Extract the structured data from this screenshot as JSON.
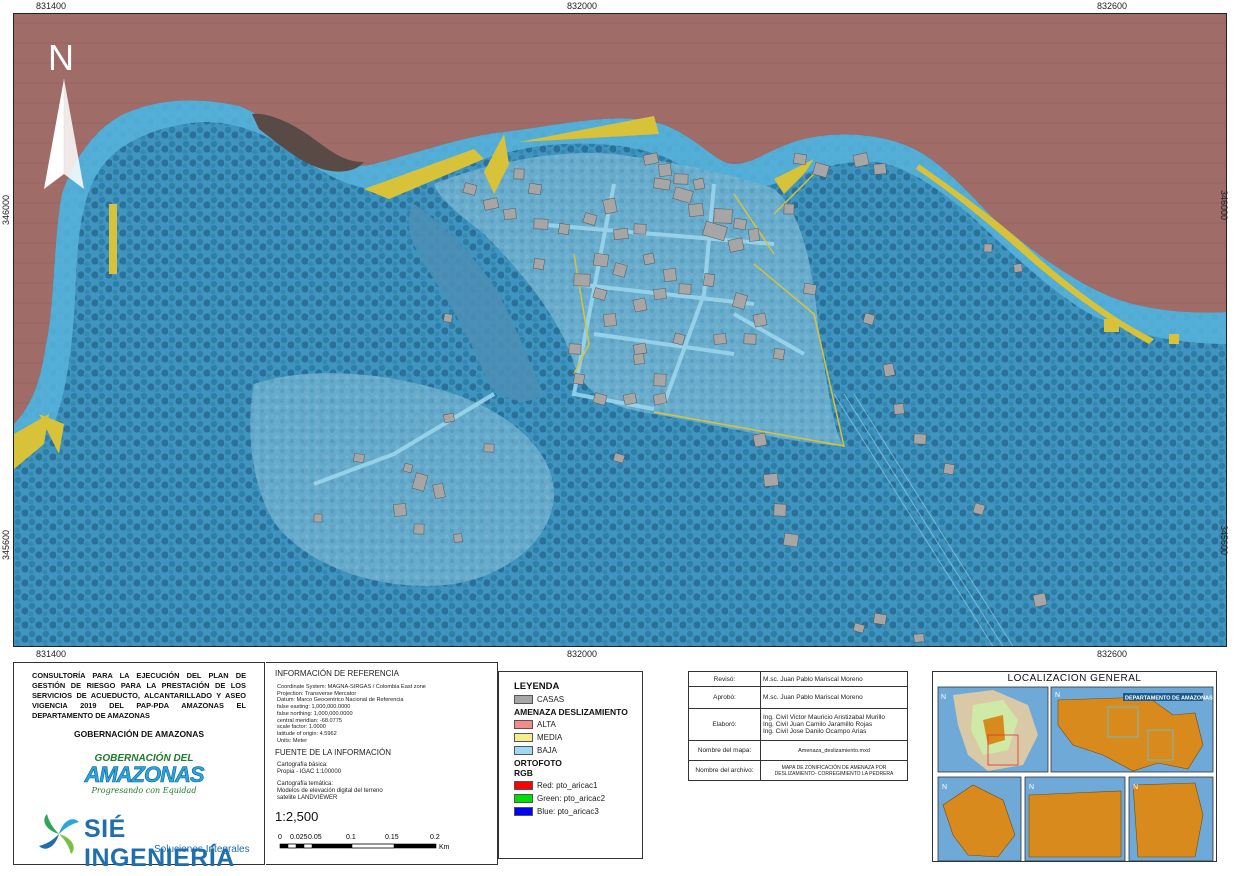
{
  "map": {
    "coords_top": [
      "831400",
      "832000",
      "832600"
    ],
    "coords_bottom": [
      "831400",
      "832000",
      "832600"
    ],
    "coords_left": [
      "346000",
      "345600"
    ],
    "coords_right": [
      "346000",
      "345600"
    ],
    "north_label": "N"
  },
  "title_block": {
    "title": "CONSULTORÍA PARA LA EJECUCIÓN DEL PLAN DE GESTIÓN DE RIESGO PARA LA PRESTACIÓN DE LOS SERVICIOS DE ACUEDUCTO, ALCANTARILLADO Y ASEO VIGENCIA 2019 DEL PAP-PDA AMAZONAS EL DEPARTAMENTO DE AMAZONAS",
    "government": "GOBERNACIÓN DE AMAZONAS",
    "logo_gob_line1": "GOBERNACIÓN DEL",
    "logo_gob_line2": "AMAZONAS",
    "logo_gob_line3": "Progresando con Equidad",
    "logo_sie_name": "SIÉ INGENIERÍA",
    "logo_sie_tagline": "Soluciones Integrales"
  },
  "reference": {
    "heading": "INFORMACIÓN DE REFERENCIA",
    "lines": [
      "Coordinate System: MAGNA-SIRGAS / Colombia East zone",
      "Projection: Transverse Mercator",
      "Datum: Marco Geocentrico Nacional de Referencia",
      "false easting: 1,000,000.0000",
      "false northing: 1,000,000.0000",
      "central meridian: -68.0775",
      "scale factor: 1.0000",
      "latitude of origin: 4.5962",
      "Units: Meter"
    ],
    "source_heading": "FUENTE DE LA INFORMACIÓN",
    "source_lines": [
      "Cartografía básica:",
      "Propia - IGAC 1:100000"
    ],
    "thematic_lines": [
      "Cartografía temática:",
      "Modelos de elevación digital del terreno",
      "satelite LANDVIEWER"
    ],
    "scale": "1:2,500",
    "scale_ticks": [
      "0",
      "0.025",
      "0.05",
      "0.1",
      "0.15",
      "0.2"
    ],
    "scale_unit": "Km"
  },
  "legend": {
    "title": "LEYENDA",
    "houses_label": "CASAS",
    "hazard_heading": "AMENAZA DESLIZAMIENTO",
    "hazard_items": [
      {
        "label": "ALTA",
        "color": "#f28b8b"
      },
      {
        "label": "MEDIA",
        "color": "#f2ef8b"
      },
      {
        "label": "BAJA",
        "color": "#9fd8f2"
      }
    ],
    "ortho_heading": "ORTOFOTO",
    "rgb_heading": "RGB",
    "rgb_items": [
      {
        "label": "Red:    pto_aricac1",
        "color": "#ff0000"
      },
      {
        "label": "Green: pto_aricac2",
        "color": "#00e000"
      },
      {
        "label": "Blue:   pto_aricac3",
        "color": "#0000ff"
      }
    ],
    "houses_color": "#a6a6a6"
  },
  "credits": {
    "reviewed_key": "Revisó:",
    "reviewed_val": "M.sc. Juan Pablo Mariscal Moreno",
    "approved_key": "Aprobó:",
    "approved_val": "M.sc. Juan Pablo Mariscal Moreno",
    "made_key": "Elaboró:",
    "made_vals": [
      "Ing. Civil Victor Mauricio Aristizabal Murillo",
      "Ing. Civil Juan Camilo Jaramillo Rojas",
      "Ing. Civil Jose Danilo Ocampo Arias"
    ],
    "map_name_key": "Nombre del mapa:",
    "map_name_val": "Amenaza_deslizamiento.mxd",
    "file_name_key": "Nombre del archivo:",
    "file_name_val": "MAPA DE ZONIFICACIÓN DE AMENAZA POR DESLIZAMIENTO- CORREGIMIENTO LA PEDRERA"
  },
  "location": {
    "title": "LOCALIZACION GENERAL",
    "inset_label": "DEPARTAMENTO DE AMAZONAS"
  },
  "colors": {
    "river": "#9e6a67",
    "hazard_low": "#4ea6cf",
    "hazard_mid": "#d8c23a",
    "forest": "#2f7aa0",
    "orange_inset": "#d98a1c"
  }
}
